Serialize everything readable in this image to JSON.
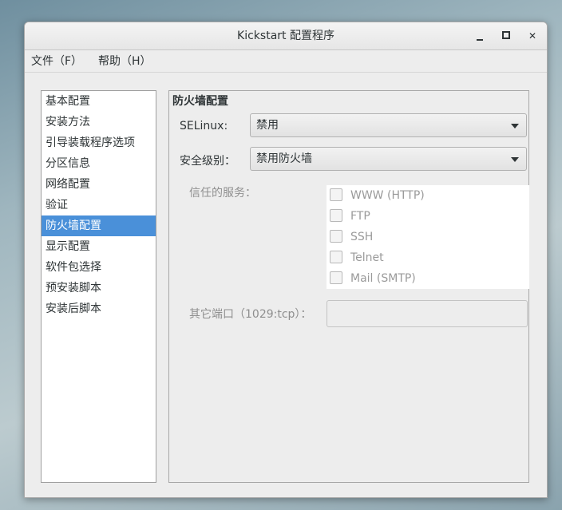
{
  "window": {
    "title": "Kickstart 配置程序",
    "minimize_glyph": "—",
    "maximize_glyph": "▫",
    "close_glyph": "✕"
  },
  "menubar": {
    "file": "文件（F）",
    "help": "帮助（H）"
  },
  "sidebar": {
    "items": [
      {
        "label": "基本配置",
        "selected": false
      },
      {
        "label": "安装方法",
        "selected": false
      },
      {
        "label": "引导装载程序选项",
        "selected": false
      },
      {
        "label": "分区信息",
        "selected": false
      },
      {
        "label": "网络配置",
        "selected": false
      },
      {
        "label": "验证",
        "selected": false
      },
      {
        "label": "防火墙配置",
        "selected": true
      },
      {
        "label": "显示配置",
        "selected": false
      },
      {
        "label": "软件包选择",
        "selected": false
      },
      {
        "label": "预安装脚本",
        "selected": false
      },
      {
        "label": "安装后脚本",
        "selected": false
      }
    ]
  },
  "firewall": {
    "section_title": "防火墙配置",
    "selinux_label": "SELinux:",
    "selinux_value": "禁用",
    "security_level_label": "安全级别：",
    "security_level_value": "禁用防火墙",
    "trusted_services_label": "信任的服务：",
    "services": [
      {
        "label": "WWW (HTTP)",
        "checked": false,
        "enabled": false
      },
      {
        "label": "FTP",
        "checked": false,
        "enabled": false
      },
      {
        "label": "SSH",
        "checked": false,
        "enabled": false
      },
      {
        "label": "Telnet",
        "checked": false,
        "enabled": false
      },
      {
        "label": "Mail (SMTP)",
        "checked": false,
        "enabled": false
      }
    ],
    "other_ports_label": "其它端口（1029:tcp）：",
    "other_ports_value": ""
  },
  "colors": {
    "selection": "#4a90d9",
    "window_bg": "#ededed",
    "disabled_text": "#8f8f8f"
  }
}
